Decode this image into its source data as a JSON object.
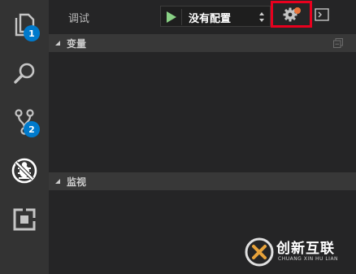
{
  "activity_bar": {
    "items": [
      {
        "icon": "files-icon",
        "badge": "1"
      },
      {
        "icon": "search-icon"
      },
      {
        "icon": "source-control-icon",
        "badge": "2"
      },
      {
        "icon": "debug-icon",
        "active": true
      },
      {
        "icon": "extensions-icon"
      }
    ]
  },
  "debug_panel": {
    "title": "调试",
    "config_select": {
      "value": "没有配置"
    },
    "sections": [
      {
        "label": "变量"
      },
      {
        "label": "监视"
      }
    ]
  },
  "colors": {
    "activity_bar_bg": "#333333",
    "sidebar_bg": "#252526",
    "section_header_bg": "#383838",
    "badge_bg": "#007acc",
    "play_green": "#89d185",
    "highlight_box": "#e8001e",
    "gear_dot": "#e8743b"
  },
  "watermark": {
    "text": "创新互联",
    "subtext": "CHUANG XIN HU LIAN"
  }
}
